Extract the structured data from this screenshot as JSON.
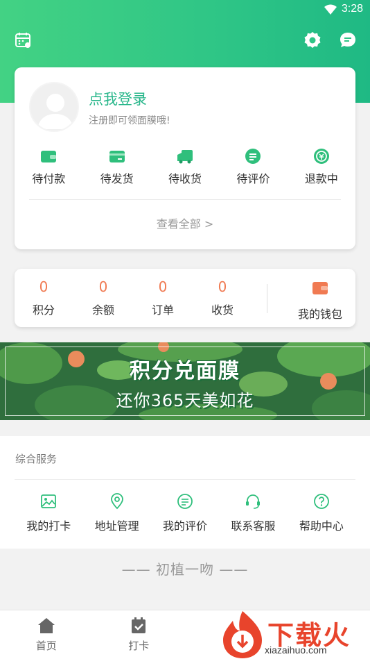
{
  "status_bar": {
    "time": "3:28",
    "icons": [
      "wifi-icon",
      "battery-icon"
    ]
  },
  "header": {
    "left_icon": "calendar-icon",
    "right_icons": [
      "gear-icon",
      "message-icon"
    ],
    "accent": "#2ec586"
  },
  "login": {
    "title": "点我登录",
    "subtitle": "注册即可领面膜哦!",
    "avatar_icon": "user-avatar-icon"
  },
  "orders": {
    "items": [
      {
        "label": "待付款",
        "icon": "wallet-icon"
      },
      {
        "label": "待发货",
        "icon": "card-icon"
      },
      {
        "label": "待收货",
        "icon": "truck-icon"
      },
      {
        "label": "待评价",
        "icon": "comment-icon"
      },
      {
        "label": "退款中",
        "icon": "refund-icon"
      }
    ],
    "view_all": "查看全部 >"
  },
  "stats": {
    "items": [
      {
        "value": "0",
        "label": "积分"
      },
      {
        "value": "0",
        "label": "余额"
      },
      {
        "value": "0",
        "label": "订单"
      },
      {
        "value": "0",
        "label": "收货"
      }
    ],
    "wallet_label": "我的钱包",
    "number_color": "#f07a52"
  },
  "banner": {
    "line1": "积分兑面膜",
    "line2": "还你365天美如花"
  },
  "services": {
    "title": "综合服务",
    "items": [
      {
        "label": "我的打卡",
        "icon": "image-icon"
      },
      {
        "label": "地址管理",
        "icon": "location-icon"
      },
      {
        "label": "我的评价",
        "icon": "comment-icon"
      },
      {
        "label": "联系客服",
        "icon": "headset-icon"
      },
      {
        "label": "帮助中心",
        "icon": "help-icon"
      }
    ]
  },
  "footer_note": "—— 初植一吻 ——",
  "tabbar": {
    "items": [
      {
        "label": "首页",
        "icon": "home-icon"
      },
      {
        "label": "打卡",
        "icon": "checkin-icon"
      }
    ]
  },
  "watermark": {
    "text": "下载火",
    "sub": "xiazaihuo.com"
  }
}
